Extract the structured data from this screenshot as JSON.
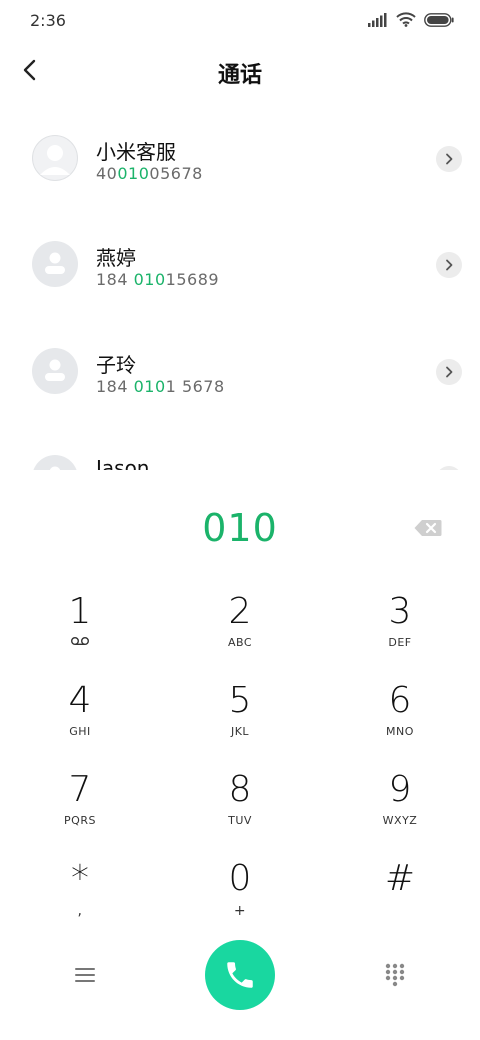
{
  "status_bar": {
    "time": "2:36"
  },
  "header": {
    "title": "通话"
  },
  "contacts": [
    {
      "name": "小米客服",
      "number_pre": "40",
      "number_match": "010",
      "number_post": "05678",
      "avatar": "silhouette-light"
    },
    {
      "name": "燕婷",
      "number_pre": "184 ",
      "number_match": "010",
      "number_post": "15689",
      "avatar": "person-icon"
    },
    {
      "name": "子玲",
      "number_pre": "184 ",
      "number_match": "010",
      "number_post": "1 5678",
      "avatar": "person-icon"
    },
    {
      "name": "Jason",
      "number_pre": "",
      "number_match": "",
      "number_post": "",
      "avatar": "person-icon"
    }
  ],
  "dial": {
    "input": "010"
  },
  "keypad": [
    {
      "digit": "1",
      "letters": ""
    },
    {
      "digit": "2",
      "letters": "ABC"
    },
    {
      "digit": "3",
      "letters": "DEF"
    },
    {
      "digit": "4",
      "letters": "GHI"
    },
    {
      "digit": "5",
      "letters": "JKL"
    },
    {
      "digit": "6",
      "letters": "MNO"
    },
    {
      "digit": "7",
      "letters": "PQRS"
    },
    {
      "digit": "8",
      "letters": "TUV"
    },
    {
      "digit": "9",
      "letters": "WXYZ"
    },
    {
      "digit": "*",
      "letters": ","
    },
    {
      "digit": "0",
      "letters": "+"
    },
    {
      "digit": "#",
      "letters": ""
    }
  ],
  "colors": {
    "accent": "#1bb36a",
    "call_button": "#19d7a0"
  }
}
